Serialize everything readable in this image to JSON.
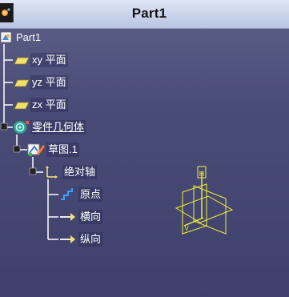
{
  "window": {
    "title": "Part1"
  },
  "tree": {
    "root": {
      "label": "Part1",
      "icon": "part-icon"
    },
    "planes": [
      {
        "label": "xy 平面",
        "icon": "plane-icon"
      },
      {
        "label": "yz 平面",
        "icon": "plane-icon"
      },
      {
        "label": "zx 平面",
        "icon": "plane-icon"
      }
    ],
    "body": {
      "label": "零件几何体",
      "icon": "part-body-icon"
    },
    "sketch": {
      "label": "草图.1",
      "icon": "sketch-icon"
    },
    "axis": {
      "label": "绝对轴",
      "icon": "axis-system-icon"
    },
    "axis_children": [
      {
        "label": "原点",
        "icon": "origin-icon"
      },
      {
        "label": "横向",
        "icon": "horizontal-direction-icon"
      },
      {
        "label": "纵向",
        "icon": "vertical-direction-icon"
      }
    ]
  },
  "viewport": {
    "gizmo": {
      "h_label": "H",
      "v_label": "V",
      "color": "#f2f232"
    }
  },
  "colors": {
    "background_top": "#5d6188",
    "background_bottom": "#3f416c",
    "titlebar": "#c9d4ea",
    "tree_line": "#ffffff",
    "gizmo": "#f2f232",
    "plane_icon": "#f0e070"
  }
}
